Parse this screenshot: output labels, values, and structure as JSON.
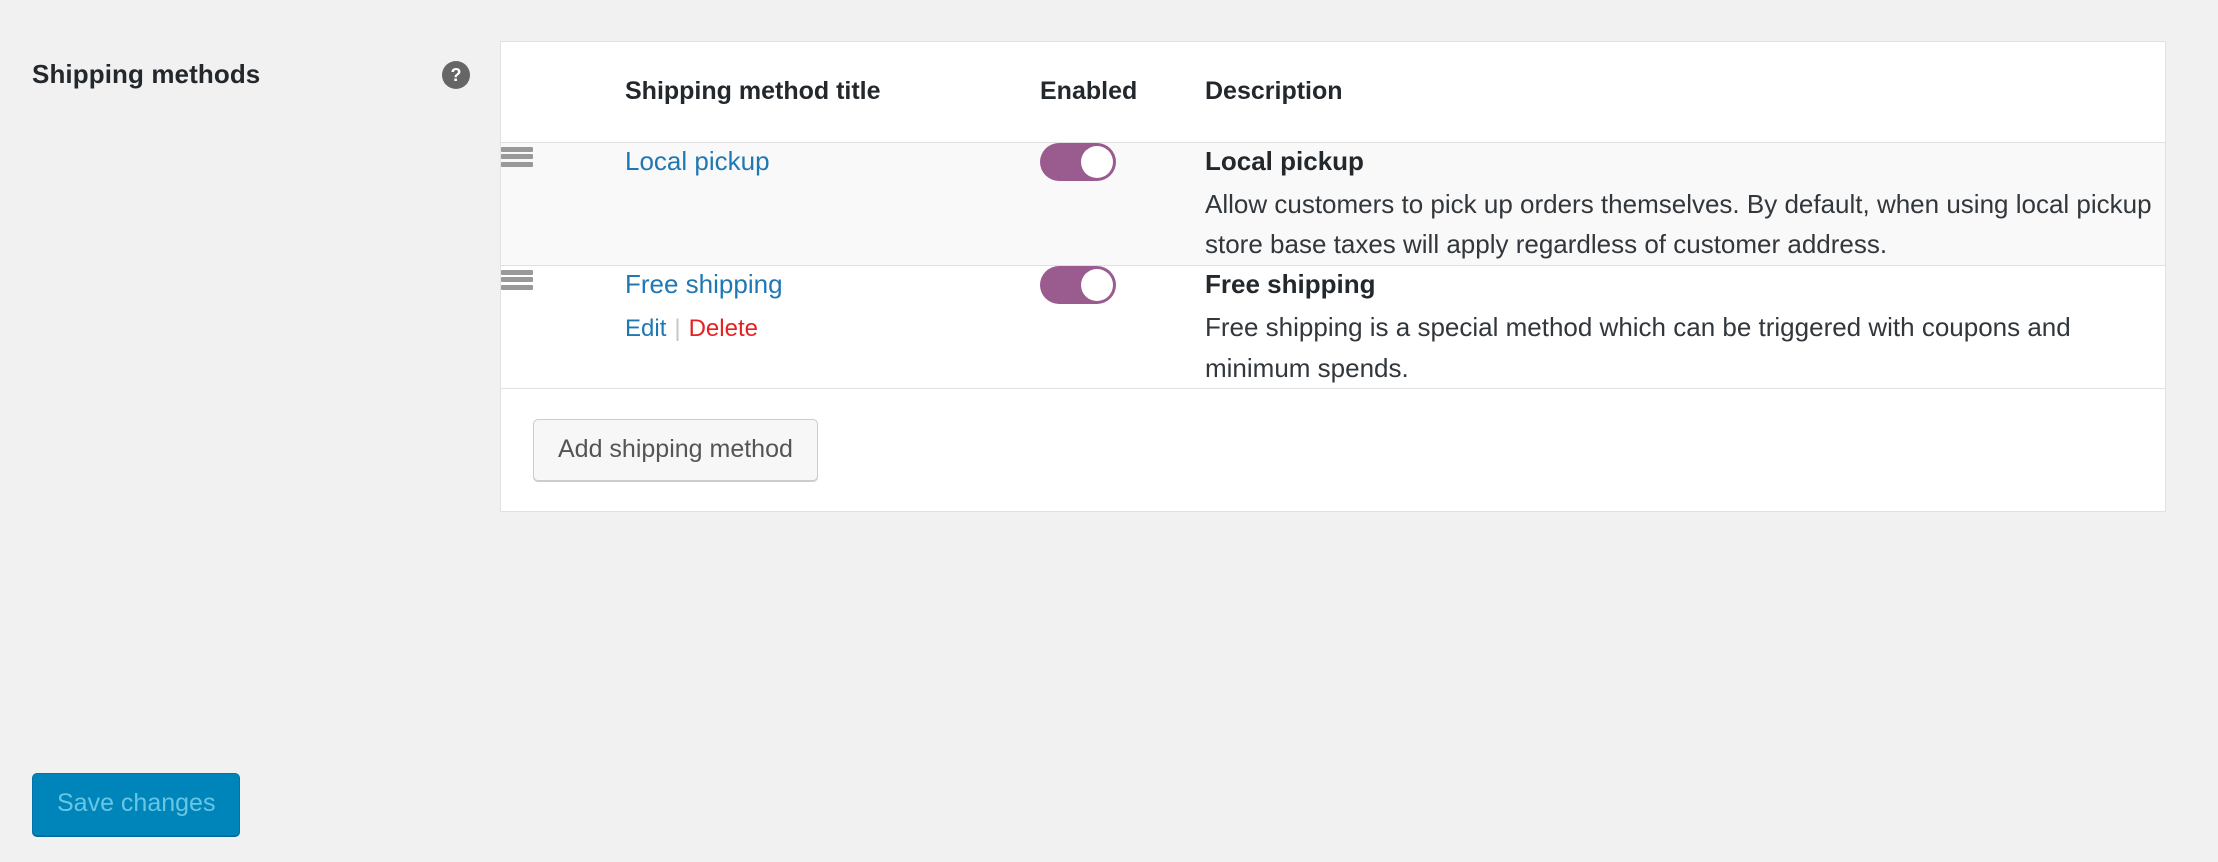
{
  "field": {
    "label": "Shipping methods",
    "help_icon": "help-icon",
    "help_glyph": "?"
  },
  "table": {
    "columns": {
      "sort": "",
      "title": "Shipping method title",
      "enabled": "Enabled",
      "description": "Description"
    },
    "rows": [
      {
        "drag_icon": "drag-handle-icon",
        "title": "Local pickup",
        "enabled": true,
        "actions": [],
        "desc_title": "Local pickup",
        "desc_body": "Allow customers to pick up orders themselves. By default, when using local pickup store base taxes will apply regardless of customer address."
      },
      {
        "drag_icon": "drag-handle-icon",
        "title": "Free shipping",
        "enabled": true,
        "actions": [
          {
            "label": "Edit",
            "kind": "edit"
          },
          {
            "label": "Delete",
            "kind": "delete"
          }
        ],
        "action_separator": "|",
        "desc_title": "Free shipping",
        "desc_body": "Free shipping is a special method which can be triggered with coupons and minimum spends."
      }
    ]
  },
  "footer": {
    "add_method_label": "Add shipping method"
  },
  "save": {
    "label": "Save changes"
  },
  "colors": {
    "link": "#1f78b4",
    "delete": "#e52222",
    "toggle_on": "#9a5b8f",
    "primary_button_bg": "#0085ba",
    "primary_button_text": "#66c6e4",
    "page_bg": "#f1f1f1",
    "alt_row_bg": "#f9f9f9"
  }
}
